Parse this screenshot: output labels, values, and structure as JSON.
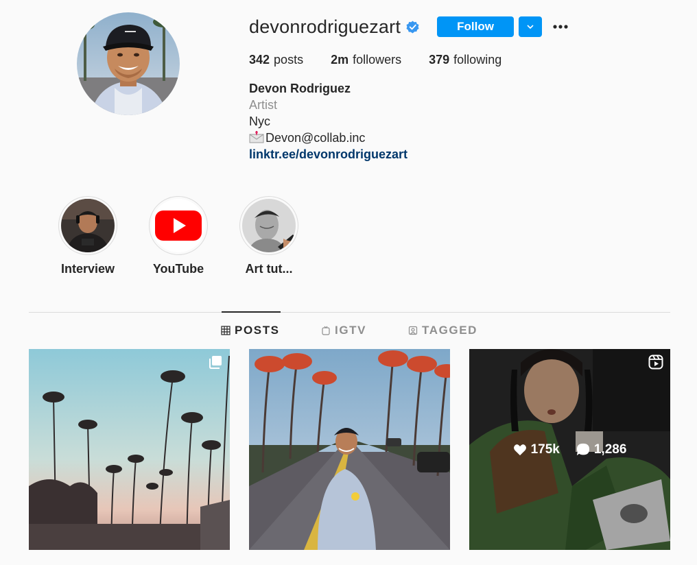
{
  "profile": {
    "username": "devonrodriguezart",
    "verified": true,
    "follow_label": "Follow",
    "stats": {
      "posts_count": "342",
      "posts_label": "posts",
      "followers_count": "2m",
      "followers_label": "followers",
      "following_count": "379",
      "following_label": "following"
    },
    "bio": {
      "full_name": "Devon Rodriguez",
      "category": "Artist",
      "location": "Nyc",
      "email_line": "Devon@collab.inc",
      "link": "linktr.ee/devonrodriguezart"
    }
  },
  "highlights": [
    {
      "label": "Interview",
      "icon": "person-thumbnail"
    },
    {
      "label": "YouTube",
      "icon": "youtube-logo"
    },
    {
      "label": "Art tut...",
      "icon": "sketch-thumbnail"
    }
  ],
  "tabs": [
    {
      "label": "POSTS",
      "icon": "grid-icon",
      "active": true
    },
    {
      "label": "IGTV",
      "icon": "igtv-icon",
      "active": false
    },
    {
      "label": "TAGGED",
      "icon": "tagged-icon",
      "active": false
    }
  ],
  "posts": [
    {
      "type": "carousel",
      "description_icon": "carousel-icon"
    },
    {
      "type": "photo"
    },
    {
      "type": "reel",
      "description_icon": "reels-icon",
      "likes": "175k",
      "comments": "1,286"
    }
  ],
  "colors": {
    "accent": "#0095f6",
    "link": "#00376b",
    "muted": "#8e8e8e",
    "youtube_red": "#ff0000"
  }
}
